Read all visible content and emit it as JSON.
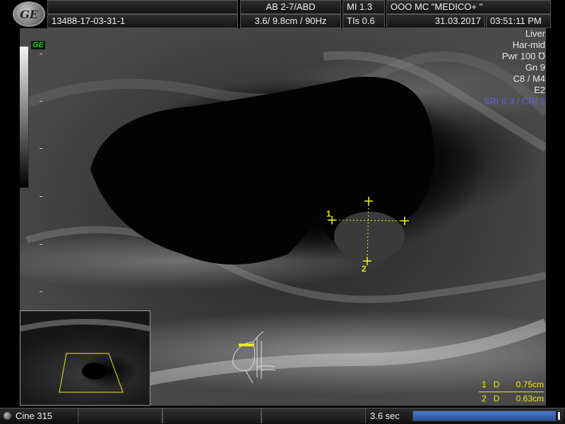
{
  "header": {
    "logo_text": "GE",
    "probe_preset": "AB 2-7/ABD",
    "mi": "MI  1.3",
    "institution": "OOO  MC \"MEDICO+ \"",
    "patient_id": "13488-17-03-31-1",
    "depth_freq": "3.6/ 9.8cm / 90Hz",
    "tis": "TIs  0.6",
    "date": "31.03.2017",
    "time": "03:51:11 PM"
  },
  "params": {
    "organ": "Liver",
    "harmonic": "Har-mid",
    "power": "Pwr 100 ℧",
    "gain": "Gn  9",
    "map": "C8 / M4",
    "e": "E2",
    "sri": "SRI II 3 / CRI 3"
  },
  "ge_tag": "GE",
  "calipers": {
    "label1": "1",
    "label2": "2"
  },
  "results": [
    {
      "index": "1",
      "label": "D",
      "value": "0.75cm"
    },
    {
      "index": "2",
      "label": "D",
      "value": "0.63cm"
    }
  ],
  "bottom": {
    "cine_label": "Cine 315",
    "seconds": "3.6 sec",
    "progress": 0.96
  },
  "colors": {
    "caliper": "#e8e820",
    "sri": "#5f5fe0",
    "ge_tag": "#1ec41e",
    "progress": "#3a62b0"
  },
  "icons": [
    "ge-logo-icon",
    "gallbladder-bodymark-icon",
    "cine-knob-icon"
  ]
}
